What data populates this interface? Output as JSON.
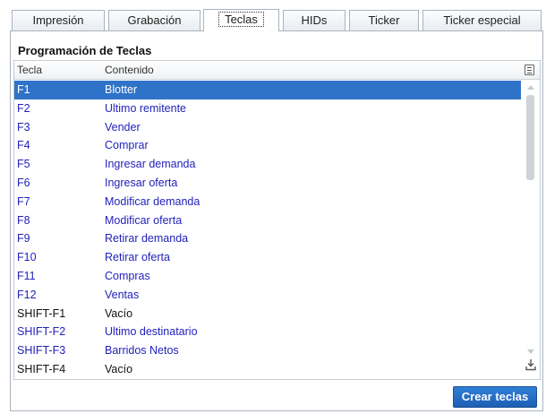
{
  "tabs": [
    {
      "label": "Impresión"
    },
    {
      "label": "Grabación"
    },
    {
      "label": "Teclas"
    },
    {
      "label": "HIDs"
    },
    {
      "label": "Ticker"
    },
    {
      "label": "Ticker especial"
    }
  ],
  "active_tab": "Teclas",
  "section": {
    "title": "Programación de Teclas"
  },
  "table": {
    "columns": [
      "Tecla",
      "Contenido"
    ],
    "rows": [
      {
        "key": "F1",
        "content": "Blotter",
        "selected": true
      },
      {
        "key": "F2",
        "content": "Ultimo remitente"
      },
      {
        "key": "F3",
        "content": "Vender"
      },
      {
        "key": "F4",
        "content": "Comprar"
      },
      {
        "key": "F5",
        "content": "Ingresar demanda"
      },
      {
        "key": "F6",
        "content": "Ingresar oferta"
      },
      {
        "key": "F7",
        "content": "Modificar demanda"
      },
      {
        "key": "F8",
        "content": "Modificar oferta"
      },
      {
        "key": "F9",
        "content": "Retirar demanda"
      },
      {
        "key": "F10",
        "content": "Retirar oferta"
      },
      {
        "key": "F11",
        "content": "Compras"
      },
      {
        "key": "F12",
        "content": "Ventas"
      },
      {
        "key": "SHIFT-F1",
        "content": "Vacío",
        "empty": true
      },
      {
        "key": "SHIFT-F2",
        "content": "Ultimo destinatario"
      },
      {
        "key": "SHIFT-F3",
        "content": "Barridos Netos"
      },
      {
        "key": "SHIFT-F4",
        "content": "Vacío",
        "empty": true
      }
    ]
  },
  "buttons": {
    "create_label": "Crear teclas"
  },
  "colors": {
    "selection": "#2f73c9",
    "link_text": "#2222bb",
    "accent_button": "#2f7fd6"
  }
}
